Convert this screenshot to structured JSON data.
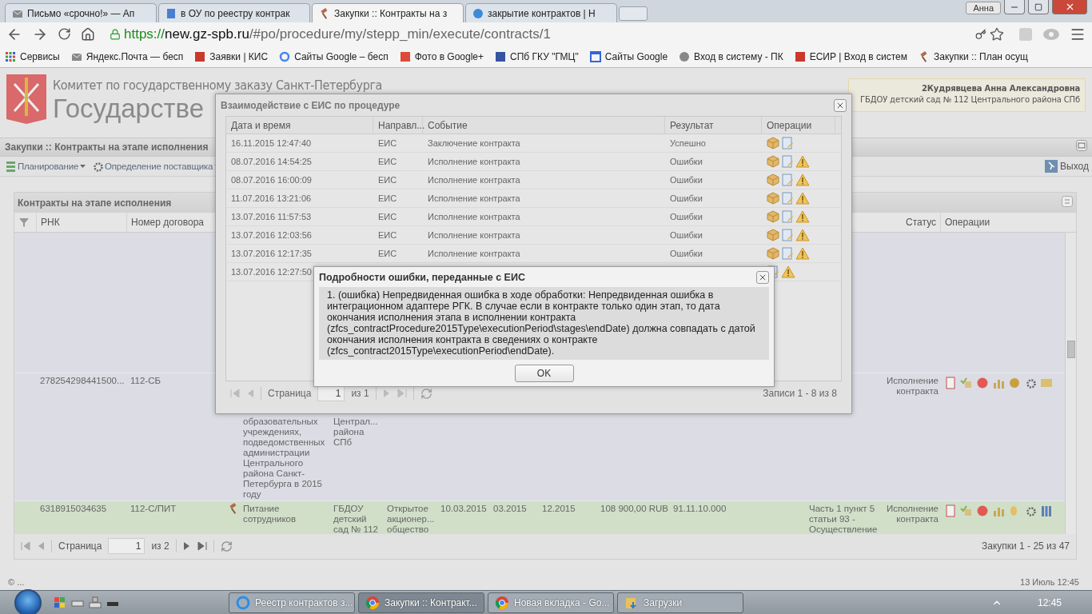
{
  "browser": {
    "tabs": [
      {
        "title": "Письмо «срочно!» — Ап",
        "selected": false
      },
      {
        "title": "в ОУ по реестру контрак",
        "selected": false
      },
      {
        "title": "Закупки :: Контракты на з",
        "selected": true
      },
      {
        "title": "закрытие контрактов | Н",
        "selected": false
      }
    ],
    "user": "Анна",
    "address": {
      "scheme": "https://",
      "host": "new.gz-spb.ru",
      "path": "/#po/procedure/my/stepp_min/execute/contracts/1"
    },
    "bookmarks": [
      "Сервисы",
      "Яндекс.Почта — бесп",
      "Заявки | КИС",
      "Сайты Google – бесп",
      "Фото в Google+",
      "СПб ГКУ \"ГМЦ\"",
      "Сайты Google",
      "Вход в систему - ПК",
      "ЕСИР | Вход в систем",
      "Закупки :: План осущ"
    ]
  },
  "page": {
    "committee": "Комитет по государственному заказу Санкт-Петербурга",
    "brand": "Государстве",
    "user_box": {
      "name": "2Кудрявцева Анна Александровна",
      "org": "ГБДОУ детский сад № 112 Центрального района СПб"
    },
    "title": "Закупки :: Контракты на этапе исполнения",
    "toolbar": [
      "Планирование",
      "Определение поставщика"
    ],
    "exit": "Выход",
    "panel": {
      "title": "Контракты на этапе исполнения",
      "columns": {
        "rnk": "РНК",
        "number": "Номер договора",
        "status": "Статус",
        "operations": "Операции"
      },
      "rows": [
        {
          "selected": false,
          "procedure_icon": false,
          "rnk": "278254298441500...",
          "number": "112-СБ",
          "name": "образовательных учреждениях, подведомственных администрации Центрального района Санкт-Петербурга в 2015 году",
          "customer": "Централ... района СПб",
          "status": "Исполнение контракта"
        },
        {
          "selected": true,
          "procedure_icon": true,
          "rnk": "6318915034635",
          "number": "112-С/ПИТ",
          "name": "Питание сотрудников",
          "customer": "ГБДОУ детский сад № 112",
          "supplier": "Открытое акционер... общество",
          "signed": "10.03.2015",
          "start": "03.2015",
          "end": "12.2015",
          "amount": "108 900,00 RUB",
          "okpd": "91.11.10.000",
          "basis": "Часть 1 пункт 5 статьи 93 - Осуществление",
          "status": "Исполнение контракта"
        }
      ],
      "pager": {
        "label": "Страница",
        "page": "1",
        "of": "из 2",
        "summary": "Закупки 1 - 25 из 47"
      }
    },
    "footer": {
      "copyright": "© ...",
      "datetime": "13 Июль 12:45"
    }
  },
  "eis_dialog": {
    "title": "Взаимодействие с ЕИС по процедуре",
    "columns": [
      "Дата и время",
      "Направл...",
      "Событие",
      "Результат",
      "Операции"
    ],
    "rows": [
      {
        "datetime": "16.11.2015 12:47:40",
        "direction": "ЕИС",
        "event": "Заключение контракта",
        "result": "Успешно",
        "warning": false
      },
      {
        "datetime": "08.07.2016 14:54:25",
        "direction": "ЕИС",
        "event": "Исполнение контракта",
        "result": "Ошибки",
        "warning": true
      },
      {
        "datetime": "08.07.2016 16:00:09",
        "direction": "ЕИС",
        "event": "Исполнение контракта",
        "result": "Ошибки",
        "warning": true
      },
      {
        "datetime": "11.07.2016 13:21:06",
        "direction": "ЕИС",
        "event": "Исполнение контракта",
        "result": "Ошибки",
        "warning": true
      },
      {
        "datetime": "13.07.2016 11:57:53",
        "direction": "ЕИС",
        "event": "Исполнение контракта",
        "result": "Ошибки",
        "warning": true
      },
      {
        "datetime": "13.07.2016 12:03:56",
        "direction": "ЕИС",
        "event": "Исполнение контракта",
        "result": "Ошибки",
        "warning": true
      },
      {
        "datetime": "13.07.2016 12:17:35",
        "direction": "ЕИС",
        "event": "Исполнение контракта",
        "result": "Ошибки",
        "warning": true
      },
      {
        "datetime": "13.07.2016 12:27:50",
        "warning": true
      }
    ],
    "pager": {
      "label": "Страница",
      "page": "1",
      "of": "из 1",
      "summary": "Записи 1 - 8 из 8"
    }
  },
  "error_dialog": {
    "title": "Подробности ошибки, переданные с ЕИС",
    "message": "1. (ошибка) Непредвиденная ошибка в ходе обработки: Непредвиденная ошибка в интеграционном адаптере РГК. В случае если в контракте только один этап, то дата окончания исполнения этапа в исполнении контракта (zfcs_contractProcedure2015Type\\executionPeriod\\stages\\endDate) должна совпадать с датой окончания исполнения контракта в сведениях о контракте (zfcs_contract2015Type\\executionPeriod\\endDate).",
    "button": "OK"
  },
  "taskbar": {
    "tasks": [
      {
        "label": "Реестр контрактов з...",
        "selected": false
      },
      {
        "label": "Закупки :: Контракт...",
        "selected": true
      },
      {
        "label": "Новая вкладка - Go...",
        "selected": false
      },
      {
        "label": "Загрузки",
        "selected": false
      }
    ],
    "clock": "12:45"
  }
}
